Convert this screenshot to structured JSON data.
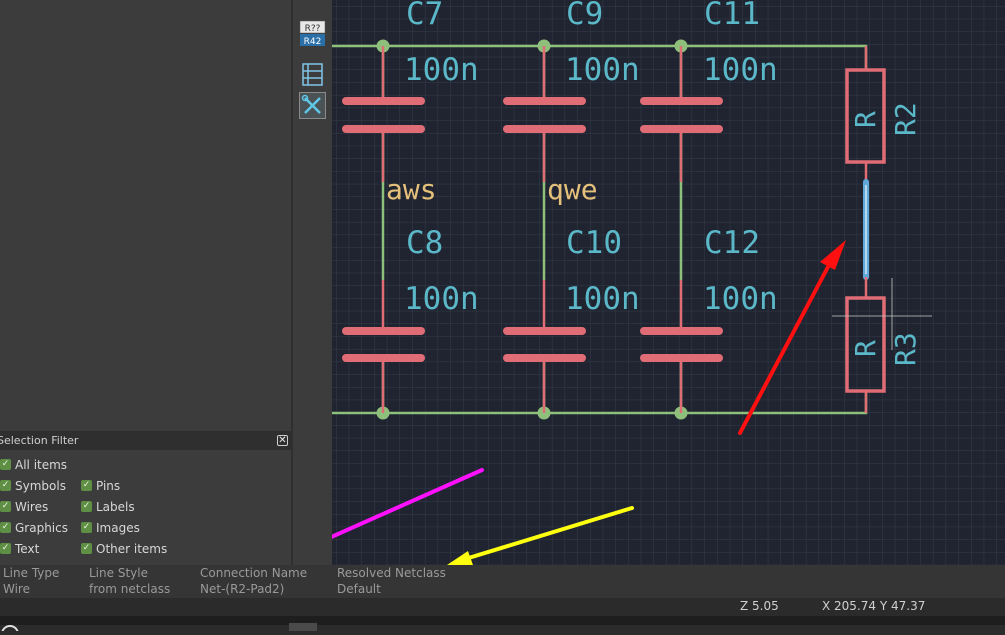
{
  "toolbar": {
    "items": [
      {
        "name": "annotate-tool",
        "label_top": "R??",
        "label_bottom": "R42"
      },
      {
        "name": "bus-layout-tool"
      },
      {
        "name": "wire-tools"
      }
    ]
  },
  "selection_filter": {
    "title": "Selection Filter",
    "close_icon": "close-icon",
    "options": [
      {
        "label": "All items",
        "checked": true
      },
      {
        "label": "Symbols",
        "checked": true
      },
      {
        "label": "Pins",
        "checked": true
      },
      {
        "label": "Wires",
        "checked": true
      },
      {
        "label": "Labels",
        "checked": true
      },
      {
        "label": "Graphics",
        "checked": true
      },
      {
        "label": "Images",
        "checked": true
      },
      {
        "label": "Text",
        "checked": true
      },
      {
        "label": "Other items",
        "checked": true
      }
    ]
  },
  "properties": {
    "line_type": {
      "key": "Line Type",
      "value": "Wire"
    },
    "line_style": {
      "key": "Line Style",
      "value": "from netclass"
    },
    "connection_name": {
      "key": "Connection Name",
      "value": "Net-(R2-Pad2)"
    },
    "resolved_netclass": {
      "key": "Resolved Netclass",
      "value": "Default"
    }
  },
  "status": {
    "zoom": "Z 5.05",
    "coords": "X 205.74  Y 47.37"
  },
  "schematic": {
    "capacitors": [
      {
        "ref": "C7",
        "value": "100n"
      },
      {
        "ref": "C9",
        "value": "100n"
      },
      {
        "ref": "C11",
        "value": "100n"
      },
      {
        "ref": "C8",
        "value": "100n"
      },
      {
        "ref": "C10",
        "value": "100n"
      },
      {
        "ref": "C12",
        "value": "100n"
      }
    ],
    "net_labels": [
      "aws",
      "qwe"
    ],
    "resistors": [
      {
        "ref": "R2",
        "value": "R"
      },
      {
        "ref": "R3",
        "value": "R"
      }
    ],
    "colors": {
      "background": "#1f2430",
      "wire": "#8ec07c",
      "component": "#e06c75",
      "reference_text": "#5bb8c9",
      "net_label": "#e5c07b",
      "selected_wire": "#5fa8d8",
      "arrow_red": "#ff1010",
      "arrow_magenta": "#ff10ff",
      "arrow_yellow": "#ffff10"
    }
  }
}
